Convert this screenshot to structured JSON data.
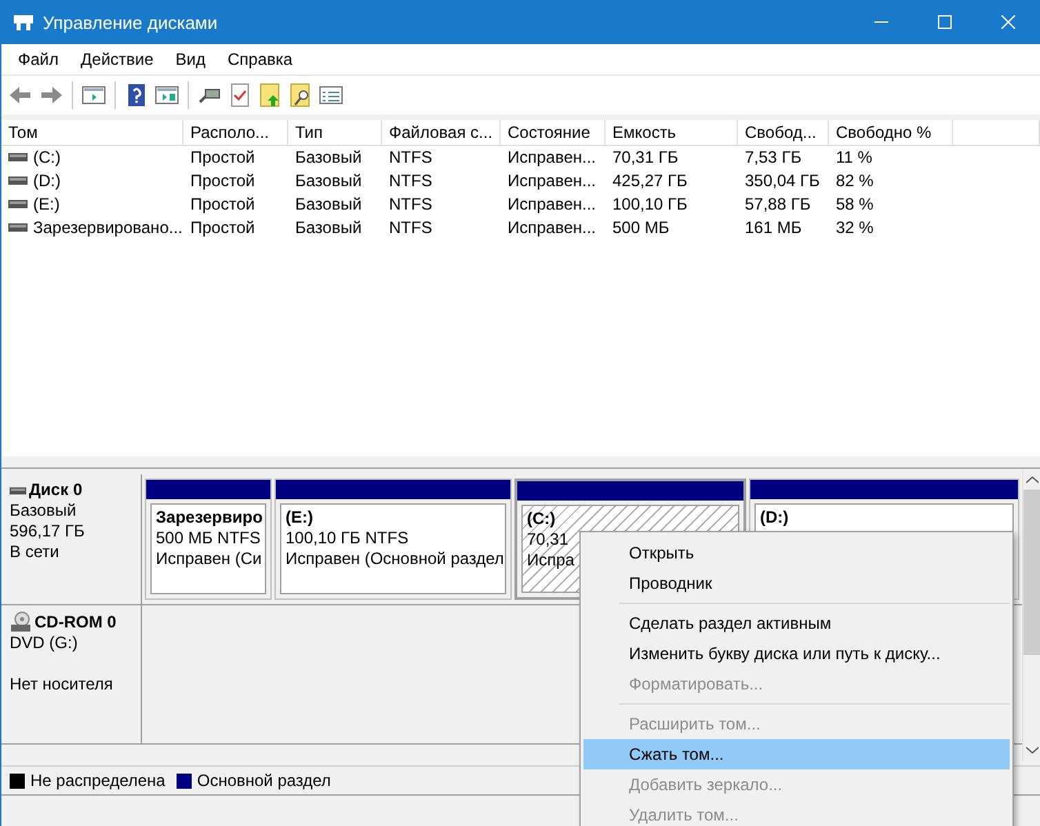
{
  "window": {
    "title": "Управление дисками"
  },
  "menu": [
    "Файл",
    "Действие",
    "Вид",
    "Справка"
  ],
  "table": {
    "columns": [
      "Том",
      "Располо...",
      "Тип",
      "Файловая с...",
      "Состояние",
      "Емкость",
      "Свобод...",
      "Свободно %"
    ],
    "rows": [
      [
        "(C:)",
        "Простой",
        "Базовый",
        "NTFS",
        "Исправен...",
        "70,31 ГБ",
        "7,53 ГБ",
        "11 %"
      ],
      [
        "(D:)",
        "Простой",
        "Базовый",
        "NTFS",
        "Исправен...",
        "425,27 ГБ",
        "350,04 ГБ",
        "82 %"
      ],
      [
        "(E:)",
        "Простой",
        "Базовый",
        "NTFS",
        "Исправен...",
        "100,10 ГБ",
        "57,88 ГБ",
        "58 %"
      ],
      [
        "Зарезервировано...",
        "Простой",
        "Базовый",
        "NTFS",
        "Исправен...",
        "500 МБ",
        "161 МБ",
        "32 %"
      ]
    ]
  },
  "disks": [
    {
      "kind": "disk",
      "name": "Диск 0",
      "lines": [
        "Базовый",
        "596,17 ГБ",
        "В сети"
      ],
      "partitions": [
        {
          "name": "Зарезервиро",
          "lines": [
            "500 МБ NTFS",
            "Исправен (Си"
          ],
          "selected": false
        },
        {
          "name": "(E:)",
          "lines": [
            "100,10 ГБ NTFS",
            "Исправен (Основной раздел"
          ],
          "selected": false
        },
        {
          "name": "(C:)",
          "lines": [
            "70,31",
            "Испра"
          ],
          "selected": true
        },
        {
          "name": "(D:)",
          "selected": false
        }
      ]
    },
    {
      "kind": "cdrom",
      "name": "CD-ROM 0",
      "lines": [
        "DVD (G:)",
        "Нет носителя"
      ]
    }
  ],
  "legend": [
    {
      "label": "Не распределена",
      "color": "#000000"
    },
    {
      "label": "Основной раздел",
      "color": "#000080"
    }
  ],
  "context_menu": [
    {
      "label": "Открыть",
      "disabled": false,
      "selected": false,
      "separator_after": false
    },
    {
      "label": "Проводник",
      "disabled": false,
      "selected": false,
      "separator_after": true
    },
    {
      "label": "Сделать раздел активным",
      "disabled": false,
      "selected": false,
      "separator_after": false
    },
    {
      "label": "Изменить букву диска или путь к диску...",
      "disabled": false,
      "selected": false,
      "separator_after": false
    },
    {
      "label": "Форматировать...",
      "disabled": true,
      "selected": false,
      "separator_after": true
    },
    {
      "label": "Расширить том...",
      "disabled": true,
      "selected": false,
      "separator_after": false
    },
    {
      "label": "Сжать том...",
      "disabled": false,
      "selected": true,
      "separator_after": false
    },
    {
      "label": "Добавить зеркало...",
      "disabled": true,
      "selected": false,
      "separator_after": false
    },
    {
      "label": "Удалить том...",
      "disabled": true,
      "selected": false,
      "separator_after": false
    }
  ]
}
